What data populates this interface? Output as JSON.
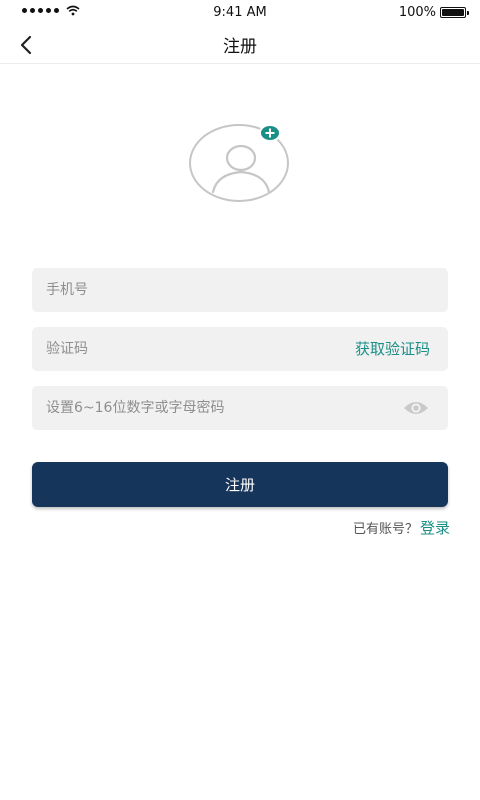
{
  "status_bar": {
    "time": "9:41 AM",
    "battery": "100%",
    "battery_level": 1.0,
    "signal_icon": "signal-dots-icon",
    "wifi_icon": "wifi-icon"
  },
  "nav": {
    "title": "注册",
    "back_icon": "chevron-left-icon"
  },
  "avatar": {
    "icon": "user-avatar-icon",
    "badge_icon": "plus-icon"
  },
  "form": {
    "phone": {
      "placeholder": "手机号",
      "value": ""
    },
    "code": {
      "placeholder": "验证码",
      "value": "",
      "get_code_label": "获取验证码"
    },
    "password": {
      "placeholder": "设置6~16位数字或字母密码",
      "value": "",
      "toggle_icon": "eye-icon"
    }
  },
  "register_button_label": "注册",
  "login_prompt": {
    "text": "已有账号？",
    "link": "登录"
  },
  "colors": {
    "accent": "#1a8f86",
    "primary_button": "#16355b",
    "field_background": "#f1f1f1",
    "placeholder": "#8e8e8e"
  }
}
